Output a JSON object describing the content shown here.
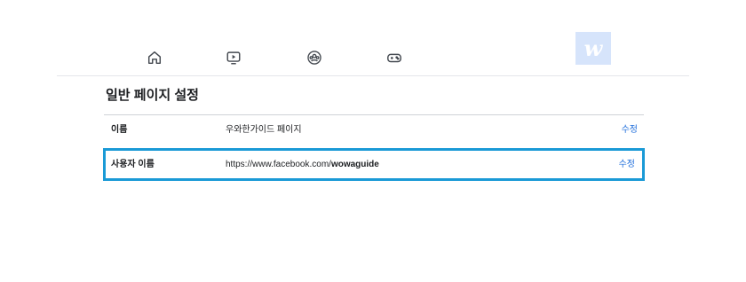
{
  "nav": {
    "icons": [
      "home-icon",
      "watch-video-icon",
      "groups-icon",
      "gaming-icon"
    ]
  },
  "logo": {
    "text": "w",
    "bg": "#d6e4fb"
  },
  "settings": {
    "title": "일반 페이지 설정",
    "rows": [
      {
        "label": "이름",
        "value": "우와한가이드 페이지",
        "action": "수정"
      },
      {
        "label": "사용자 이름",
        "value_prefix": "https://www.facebook.com/",
        "value_bold": "wowaguide",
        "action": "수정"
      }
    ]
  },
  "colors": {
    "link": "#216fdb",
    "highlight": "#1a9ad6"
  }
}
